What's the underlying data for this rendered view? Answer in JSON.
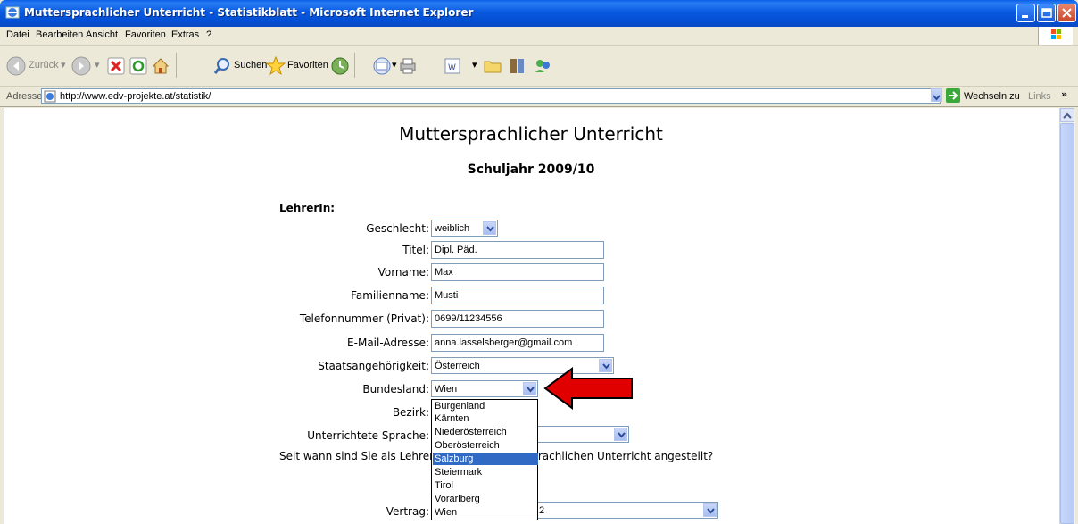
{
  "window": {
    "title": "Muttersprachlicher Unterricht - Statistikblatt - Microsoft Internet Explorer"
  },
  "menu": [
    "Datei",
    "Bearbeiten",
    "Ansicht",
    "Favoriten",
    "Extras",
    "?"
  ],
  "toolbar": {
    "back": "Zurück",
    "search": "Suchen",
    "favorites": "Favoriten"
  },
  "address": {
    "label": "Adresse",
    "url": "http://www.edv-projekte.at/statistik/",
    "go": "Wechseln zu",
    "links": "Links"
  },
  "page": {
    "title": "Muttersprachlicher Unterricht",
    "subtitle": "Schuljahr 2009/10",
    "section": "LehrerIn:",
    "question": "Seit wann sind Sie als LehrerIn für den muttersprachlichen Unterricht angestellt?"
  },
  "form": {
    "geschlecht": {
      "label": "Geschlecht:",
      "value": "weiblich"
    },
    "titel": {
      "label": "Titel:",
      "value": "Dipl. Päd."
    },
    "vorname": {
      "label": "Vorname:",
      "value": "Max"
    },
    "familienname": {
      "label": "Familienname:",
      "value": "Musti"
    },
    "telefon": {
      "label": "Telefonnummer (Privat):",
      "value": "0699/11234556"
    },
    "email": {
      "label": "E-Mail-Adresse:",
      "value": "anna.lasselsberger@gmail.com"
    },
    "staat": {
      "label": "Staatsangehörigkeit:",
      "value": "Österreich"
    },
    "bundesland": {
      "label": "Bundesland:",
      "value": "Wien"
    },
    "bezirk": {
      "label": "Bezirk:"
    },
    "sprache": {
      "label": "Unterrichtete Sprache:"
    },
    "vertrag": {
      "label": "Vertrag:",
      "value_suffix": "2"
    }
  },
  "bundesland_options": [
    "Burgenland",
    "Kärnten",
    "Niederösterreich",
    "Oberösterreich",
    "Salzburg",
    "Steiermark",
    "Tirol",
    "Vorarlberg",
    "Wien"
  ],
  "bundesland_highlighted": "Salzburg",
  "colors": {
    "titlebar": "#0a5ee6",
    "highlight": "#316ac5",
    "arrow": "#e00000"
  }
}
